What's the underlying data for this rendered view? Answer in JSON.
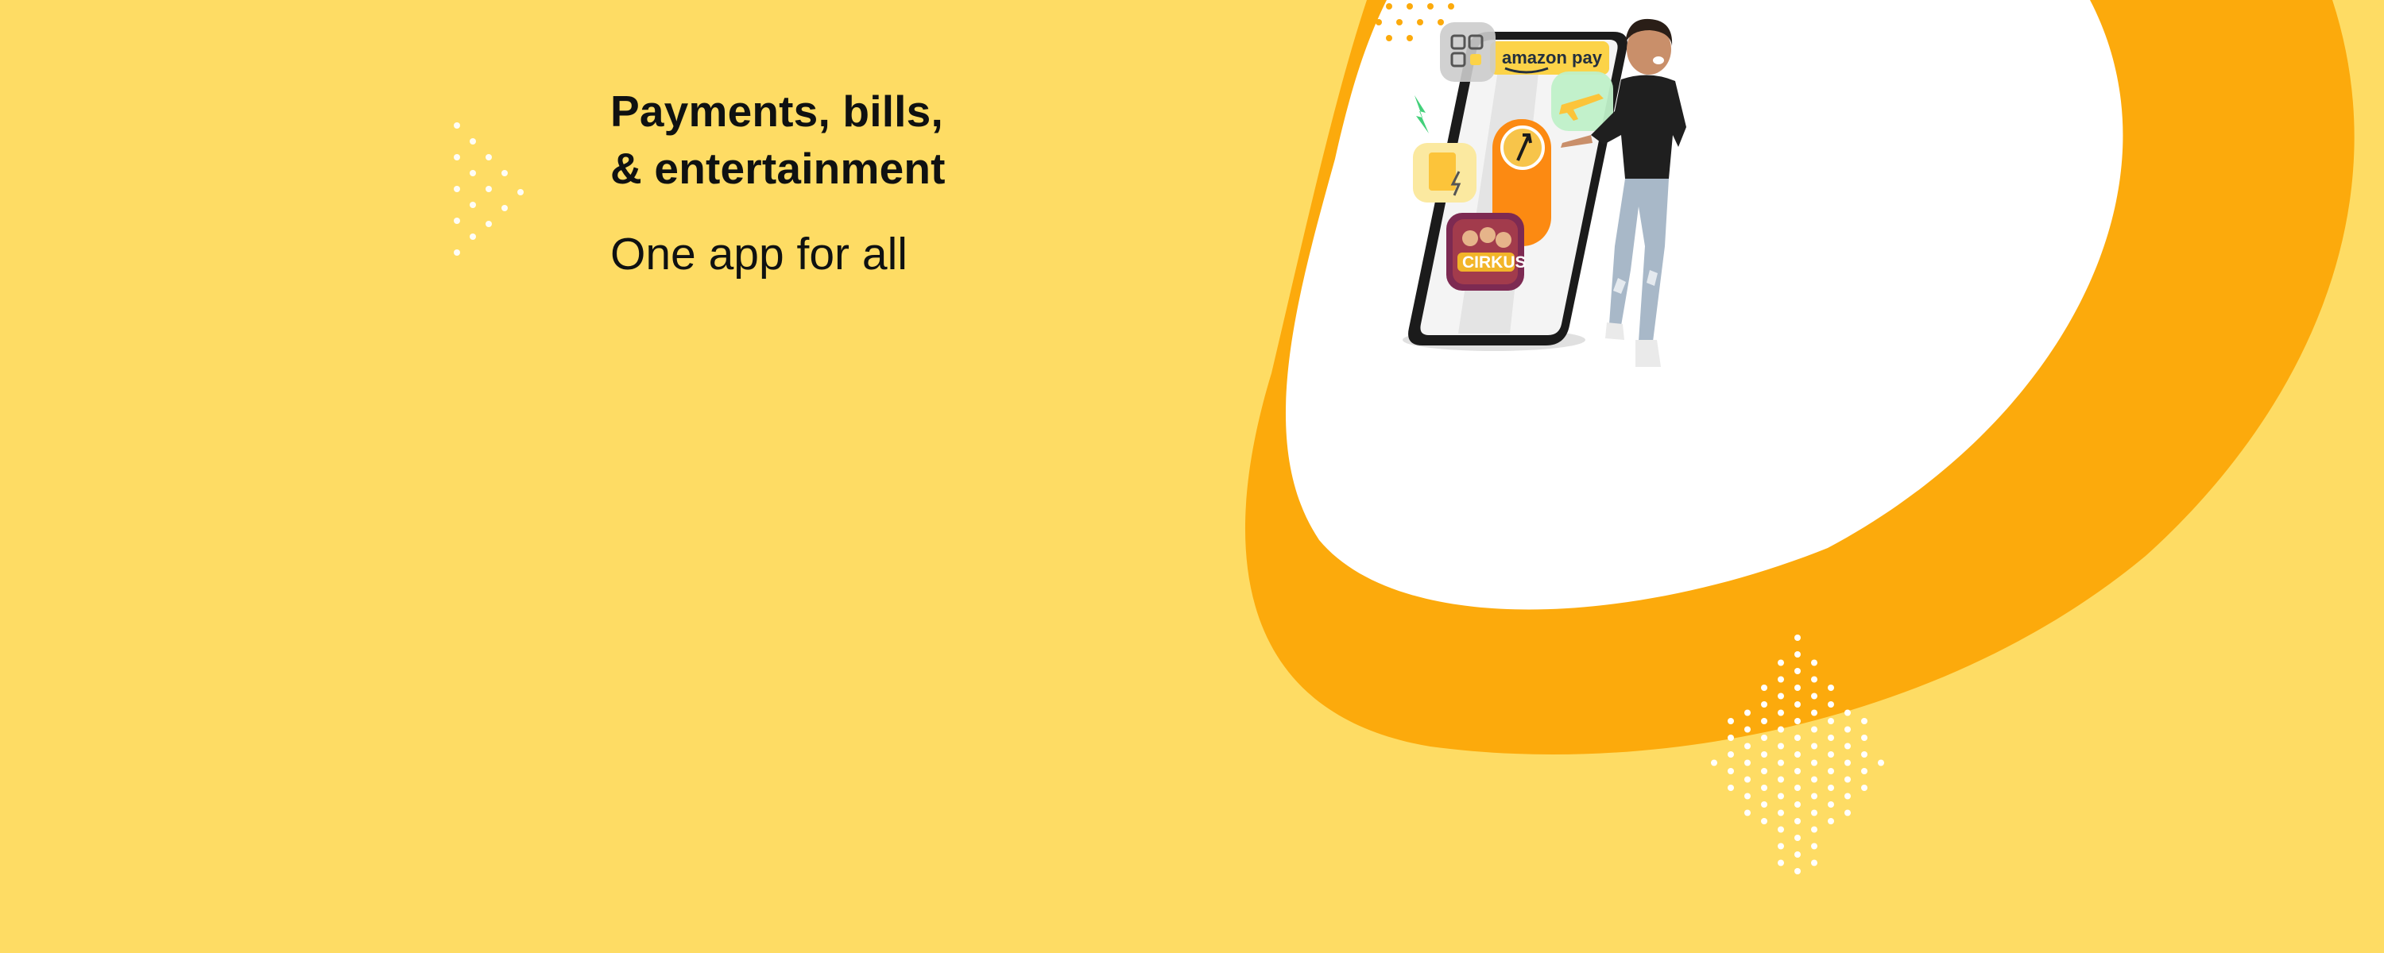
{
  "banner": {
    "headline_line1": "Payments, bills,",
    "headline_line2": "& entertainment",
    "subheadline": "One app for all",
    "colors": {
      "background": "#fedc64",
      "ring_orange": "#fcaa0c",
      "inner_white": "#ffffff",
      "text": "#0f1111",
      "dots": "#ffffff"
    }
  },
  "hero": {
    "brand_badge": "amazon pay",
    "app_tile_label": "CIRKUS",
    "icons": [
      "qr-scan-icon",
      "flight-icon",
      "bill-payment-icon",
      "upi-arrow-icon",
      "lightning-icon"
    ]
  }
}
